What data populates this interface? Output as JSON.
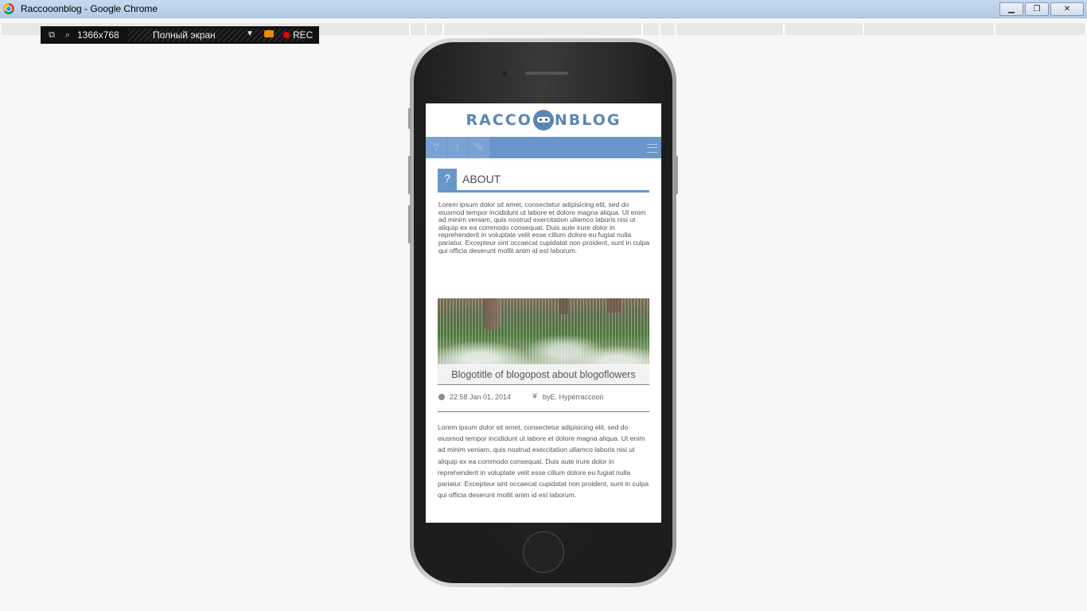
{
  "window": {
    "title": "Raccooonblog - Google Chrome",
    "minimize": "▁",
    "restore": "❐",
    "close": "✕"
  },
  "toolbar": {
    "resolution": "1366x768",
    "mode": "Полный экран",
    "rec_label": "REC"
  },
  "blog": {
    "logo_left": "RACCO",
    "logo_right": "NBLOG",
    "nav": [
      {
        "label": "?"
      },
      {
        "label": "!"
      },
      {
        "label": "✎"
      }
    ],
    "about": {
      "icon": "?",
      "title": "ABOUT",
      "text": "Lorem ipsum dolor sit amet, consectetur adipisicing elit, sed do eiusmod tempor incididunt ut labore et dolore magna aliqua. Ut enim ad minim veniam, quis nostrud exercitation ullamco laboris nisi ut aliquip ex ea commodo consequat. Duis aute irure dolor in reprehenderit in voluptate velit esse cillum dolore eu fugiat nulla pariatur. Excepteur sint occaecat cupidatat non proident, sunt in culpa qui officia deserunt mollit anim id est laborum."
    },
    "post": {
      "title": "Blogotitle of blogopost about blogoflowers",
      "date": "22:58 Jan 01, 2014",
      "author": "byE. Hyperraccoon",
      "text": "Lorem ipsum dolor sit amet, consectetur adipisicing elit, sed do eiusmod tempor incididunt ut labore et dolore magna aliqua. Ut enim ad minim veniam, quis nostrud exercitation ullamco laboris nisi ut aliquip ex ea commodo consequat. Duis aute irure dolor in reprehenderit in voluptate velit esse cillum dolore eu fugiat nulla pariatur. Excepteur sint occaecat cupidatat non proident, sunt in culpa qui officia deserunt mollit anim id est laborum."
    }
  },
  "colors": {
    "accent": "#6996cb",
    "logo": "#5b86b3"
  }
}
